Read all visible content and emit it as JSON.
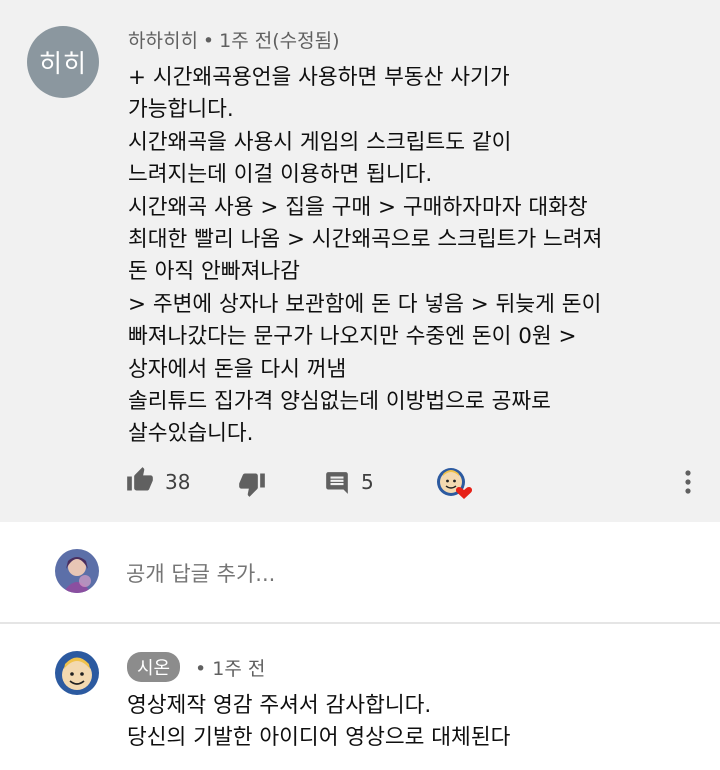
{
  "comment": {
    "avatar_text": "히히",
    "author": "하하히히",
    "time": "1주 전(수정됨)",
    "lines": [
      "+ 시간왜곡용언을 사용하면 부동산 사기가",
      "가능합니다.",
      "시간왜곡을 사용시 게임의 스크립트도 같이",
      "느려지는데 이걸 이용하면 됩니다.",
      "시간왜곡 사용 > 집을 구매 > 구매하자마자 대화창",
      "최대한 빨리 나옴 > 시간왜곡으로 스크립트가 느려져",
      "돈 아직 안빠져나감",
      "> 주변에 상자나 보관함에 돈 다 넣음 > 뒤늦게 돈이",
      "빠져나갔다는 문구가 나오지만 수중엔 돈이 0원 >",
      "상자에서 돈을 다시 꺼냄",
      "솔리튜드 집가격 양심없는데 이방법으로 공짜로",
      "살수있습니다."
    ],
    "likes": "38",
    "replies": "5",
    "icons": {
      "like": "thumbs-up-icon",
      "dislike": "thumbs-down-icon",
      "reply": "comment-icon",
      "heart": "creator-heart-icon",
      "more": "more-vert-icon"
    }
  },
  "reply_box": {
    "placeholder": "공개 답글 추가..."
  },
  "reply": {
    "author": "시온",
    "time": "1주 전",
    "lines": [
      "영상제작 영감 주셔서 감사합니다.",
      "당신의 기발한 아이디어 영상으로 대체된다"
    ]
  },
  "colors": {
    "comment_bg": "#f1f1f1",
    "heart": "#e62117",
    "meta_text": "#606060",
    "avatar_bg": "#8b979f"
  }
}
